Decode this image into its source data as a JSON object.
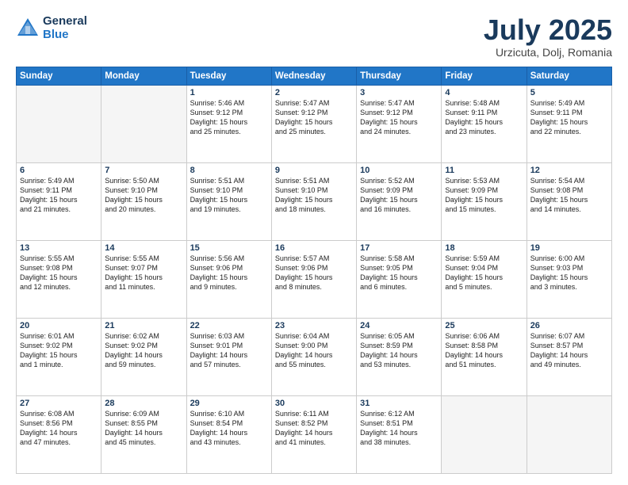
{
  "header": {
    "logo_line1": "General",
    "logo_line2": "Blue",
    "month_year": "July 2025",
    "location": "Urzicuta, Dolj, Romania"
  },
  "weekdays": [
    "Sunday",
    "Monday",
    "Tuesday",
    "Wednesday",
    "Thursday",
    "Friday",
    "Saturday"
  ],
  "weeks": [
    [
      {
        "day": "",
        "text": ""
      },
      {
        "day": "",
        "text": ""
      },
      {
        "day": "1",
        "text": "Sunrise: 5:46 AM\nSunset: 9:12 PM\nDaylight: 15 hours\nand 25 minutes."
      },
      {
        "day": "2",
        "text": "Sunrise: 5:47 AM\nSunset: 9:12 PM\nDaylight: 15 hours\nand 25 minutes."
      },
      {
        "day": "3",
        "text": "Sunrise: 5:47 AM\nSunset: 9:12 PM\nDaylight: 15 hours\nand 24 minutes."
      },
      {
        "day": "4",
        "text": "Sunrise: 5:48 AM\nSunset: 9:11 PM\nDaylight: 15 hours\nand 23 minutes."
      },
      {
        "day": "5",
        "text": "Sunrise: 5:49 AM\nSunset: 9:11 PM\nDaylight: 15 hours\nand 22 minutes."
      }
    ],
    [
      {
        "day": "6",
        "text": "Sunrise: 5:49 AM\nSunset: 9:11 PM\nDaylight: 15 hours\nand 21 minutes."
      },
      {
        "day": "7",
        "text": "Sunrise: 5:50 AM\nSunset: 9:10 PM\nDaylight: 15 hours\nand 20 minutes."
      },
      {
        "day": "8",
        "text": "Sunrise: 5:51 AM\nSunset: 9:10 PM\nDaylight: 15 hours\nand 19 minutes."
      },
      {
        "day": "9",
        "text": "Sunrise: 5:51 AM\nSunset: 9:10 PM\nDaylight: 15 hours\nand 18 minutes."
      },
      {
        "day": "10",
        "text": "Sunrise: 5:52 AM\nSunset: 9:09 PM\nDaylight: 15 hours\nand 16 minutes."
      },
      {
        "day": "11",
        "text": "Sunrise: 5:53 AM\nSunset: 9:09 PM\nDaylight: 15 hours\nand 15 minutes."
      },
      {
        "day": "12",
        "text": "Sunrise: 5:54 AM\nSunset: 9:08 PM\nDaylight: 15 hours\nand 14 minutes."
      }
    ],
    [
      {
        "day": "13",
        "text": "Sunrise: 5:55 AM\nSunset: 9:08 PM\nDaylight: 15 hours\nand 12 minutes."
      },
      {
        "day": "14",
        "text": "Sunrise: 5:55 AM\nSunset: 9:07 PM\nDaylight: 15 hours\nand 11 minutes."
      },
      {
        "day": "15",
        "text": "Sunrise: 5:56 AM\nSunset: 9:06 PM\nDaylight: 15 hours\nand 9 minutes."
      },
      {
        "day": "16",
        "text": "Sunrise: 5:57 AM\nSunset: 9:06 PM\nDaylight: 15 hours\nand 8 minutes."
      },
      {
        "day": "17",
        "text": "Sunrise: 5:58 AM\nSunset: 9:05 PM\nDaylight: 15 hours\nand 6 minutes."
      },
      {
        "day": "18",
        "text": "Sunrise: 5:59 AM\nSunset: 9:04 PM\nDaylight: 15 hours\nand 5 minutes."
      },
      {
        "day": "19",
        "text": "Sunrise: 6:00 AM\nSunset: 9:03 PM\nDaylight: 15 hours\nand 3 minutes."
      }
    ],
    [
      {
        "day": "20",
        "text": "Sunrise: 6:01 AM\nSunset: 9:02 PM\nDaylight: 15 hours\nand 1 minute."
      },
      {
        "day": "21",
        "text": "Sunrise: 6:02 AM\nSunset: 9:02 PM\nDaylight: 14 hours\nand 59 minutes."
      },
      {
        "day": "22",
        "text": "Sunrise: 6:03 AM\nSunset: 9:01 PM\nDaylight: 14 hours\nand 57 minutes."
      },
      {
        "day": "23",
        "text": "Sunrise: 6:04 AM\nSunset: 9:00 PM\nDaylight: 14 hours\nand 55 minutes."
      },
      {
        "day": "24",
        "text": "Sunrise: 6:05 AM\nSunset: 8:59 PM\nDaylight: 14 hours\nand 53 minutes."
      },
      {
        "day": "25",
        "text": "Sunrise: 6:06 AM\nSunset: 8:58 PM\nDaylight: 14 hours\nand 51 minutes."
      },
      {
        "day": "26",
        "text": "Sunrise: 6:07 AM\nSunset: 8:57 PM\nDaylight: 14 hours\nand 49 minutes."
      }
    ],
    [
      {
        "day": "27",
        "text": "Sunrise: 6:08 AM\nSunset: 8:56 PM\nDaylight: 14 hours\nand 47 minutes."
      },
      {
        "day": "28",
        "text": "Sunrise: 6:09 AM\nSunset: 8:55 PM\nDaylight: 14 hours\nand 45 minutes."
      },
      {
        "day": "29",
        "text": "Sunrise: 6:10 AM\nSunset: 8:54 PM\nDaylight: 14 hours\nand 43 minutes."
      },
      {
        "day": "30",
        "text": "Sunrise: 6:11 AM\nSunset: 8:52 PM\nDaylight: 14 hours\nand 41 minutes."
      },
      {
        "day": "31",
        "text": "Sunrise: 6:12 AM\nSunset: 8:51 PM\nDaylight: 14 hours\nand 38 minutes."
      },
      {
        "day": "",
        "text": ""
      },
      {
        "day": "",
        "text": ""
      }
    ]
  ]
}
